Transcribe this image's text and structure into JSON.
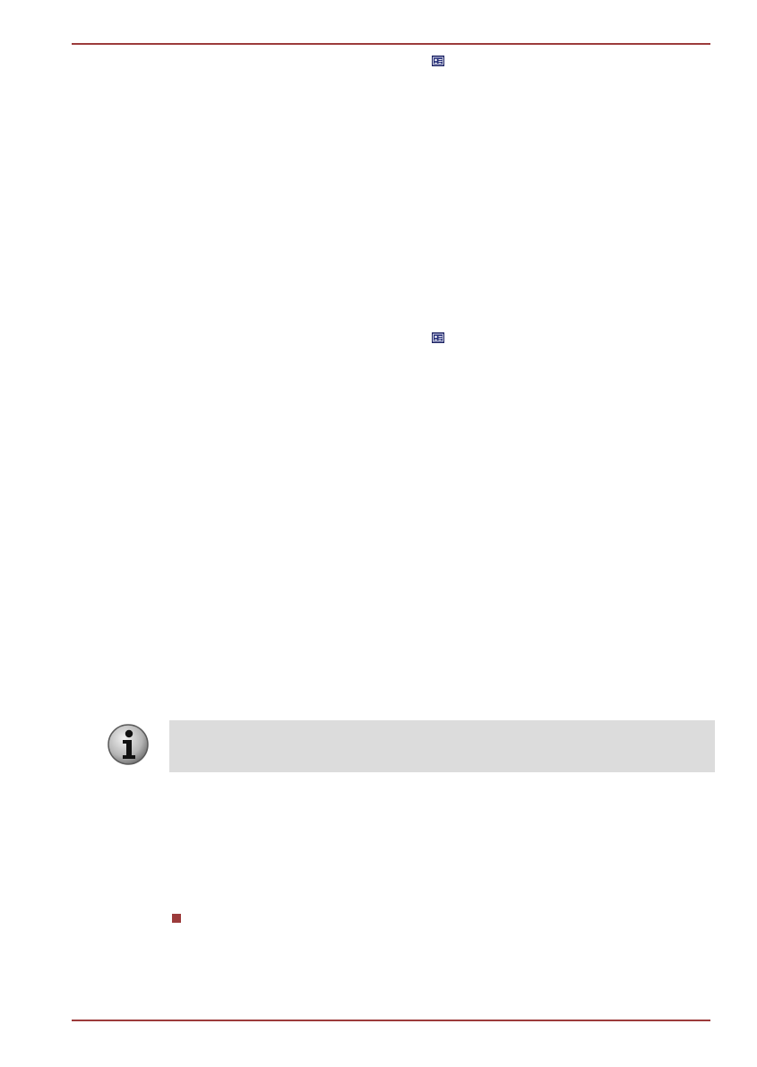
{
  "colors": {
    "rule": "#9c3b3b",
    "note_background": "#dcdcdc",
    "bullet": "#9c3b3b",
    "card_icon": "#27307a"
  },
  "icons": {
    "inline_icons": [
      "contact-card-icon",
      "contact-card-icon"
    ],
    "note_icon": "info-icon",
    "bullet": "square-bullet"
  }
}
